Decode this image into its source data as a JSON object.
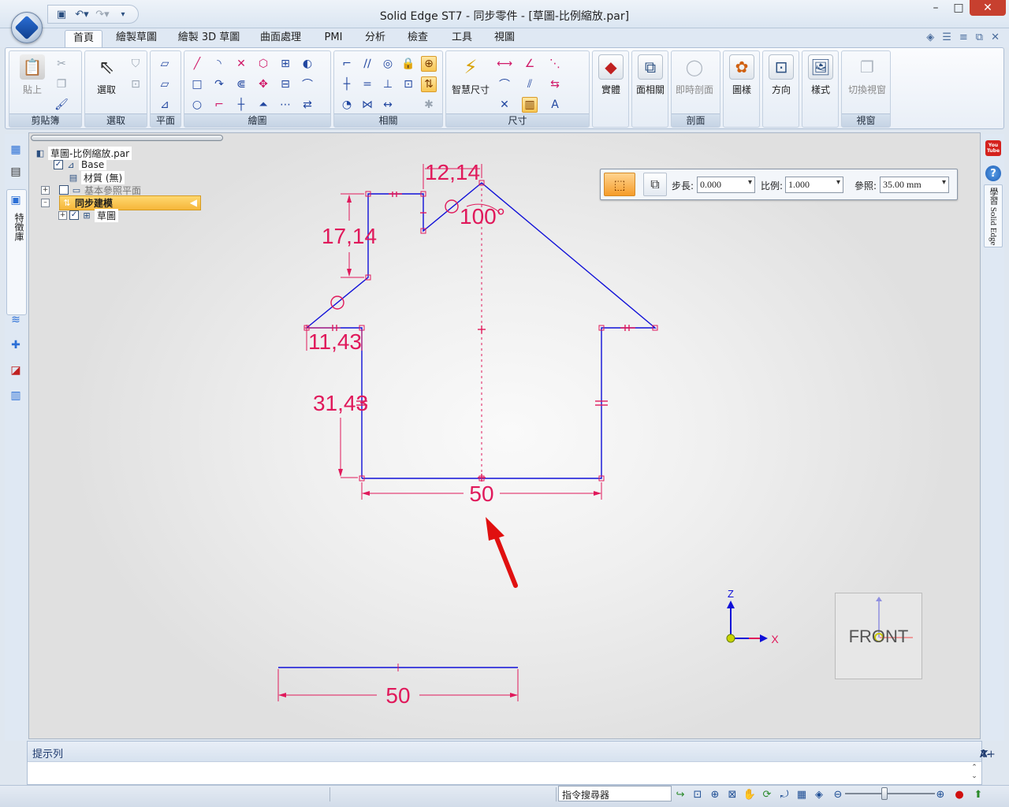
{
  "app": {
    "title": "Solid Edge ST7 - 同步零件 - [草圖-比例縮放.par]",
    "window_controls": {
      "minimize": "–",
      "maximize": "□",
      "close": "✕"
    }
  },
  "quick_access": {
    "items": [
      "save-icon",
      "undo-icon",
      "redo-icon",
      "customize-icon"
    ]
  },
  "ribbon": {
    "tabs": [
      "首頁",
      "繪製草圖",
      "繪製 3D 草圖",
      "曲面處理",
      "PMI",
      "分析",
      "檢查",
      "工具",
      "視圖"
    ],
    "active_tab": "首頁",
    "groups": {
      "clipboard": "剪貼簿",
      "select": "選取",
      "plane": "平面",
      "draw": "繪圖",
      "relate": "相關",
      "dimension": "尺寸",
      "section": "剖面",
      "window": "視窗"
    },
    "buttons": {
      "paste": "貼上",
      "select": "選取",
      "smart_dimension": "智慧尺寸",
      "solid": "實體",
      "face_related": "面相關",
      "live_section": "即時剖面",
      "pattern": "圖樣",
      "orient": "方向",
      "style": "樣式",
      "switch_window": "切換視窗"
    }
  },
  "leftbar": {
    "active_tab_label": "特徵庫"
  },
  "tree": {
    "root": "草圖-比例縮放.par",
    "base": "Base",
    "material": "材質 (無)",
    "base_planes": "基本參照平面",
    "sync_modeling": "同步建模",
    "sketch": "草圖"
  },
  "command_bar": {
    "step_label": "步長:",
    "step_value": "0.000",
    "scale_label": "比例:",
    "scale_value": "1.000",
    "reference_label": "參照:",
    "reference_value": "35.00 mm"
  },
  "sketch": {
    "dimensions": {
      "top_width": "12,14",
      "angle": "100°",
      "left_height": "17,14",
      "eave": "11,43",
      "wall_height": "31,43",
      "base_width": "50",
      "reference_line": "50"
    },
    "colors": {
      "geometry": "#1010d8",
      "dimension": "#e0195b",
      "arrow": "#e01010"
    }
  },
  "triad": {
    "z": "Z",
    "x": "X"
  },
  "viewcube": {
    "label": "FRONT"
  },
  "rightbar": {
    "youtube": "You Tube",
    "help": "?",
    "learn_label": "學習 Solid Edge"
  },
  "prompt": {
    "title": "提示列",
    "controls": [
      "A+",
      "A-",
      "⌃",
      "⊤",
      "⌄",
      "✕"
    ]
  },
  "statusbar": {
    "command_search": "指令搜尋器"
  }
}
